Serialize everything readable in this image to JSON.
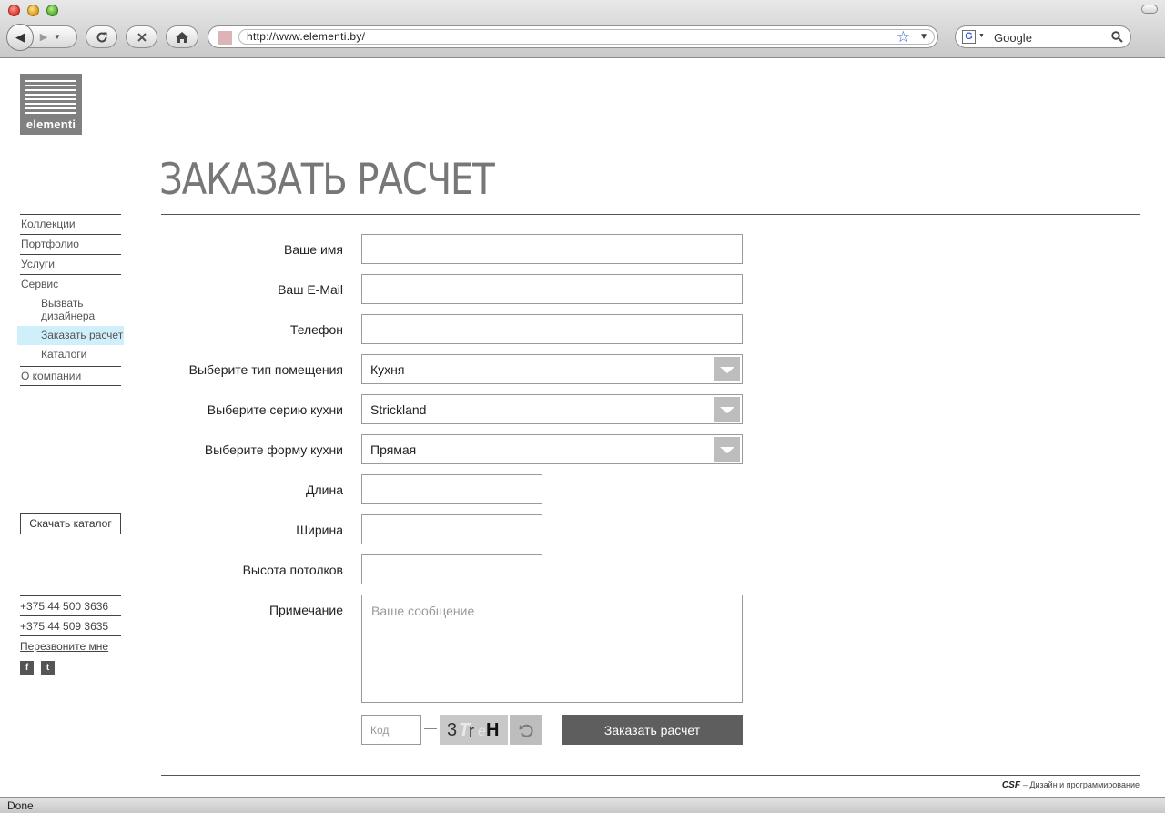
{
  "browser": {
    "url": "http://www.elementi.by/",
    "search_placeholder": "Google",
    "status": "Done"
  },
  "logo": {
    "text": "elementi"
  },
  "sidebar": {
    "items": [
      {
        "label": "Коллекции"
      },
      {
        "label": "Портфолио"
      },
      {
        "label": "Услуги"
      },
      {
        "label": "Сервис"
      },
      {
        "label": "О компании"
      }
    ],
    "subitems": [
      {
        "label": "Вызвать дизайнера"
      },
      {
        "label": "Заказать расчет",
        "active": true
      },
      {
        "label": "Каталоги"
      }
    ],
    "download_catalog": "Скачать каталог",
    "phones": [
      "+375 44 500 3636",
      "+375 44 509 3635"
    ],
    "callback": "Перезвоните мне",
    "social": {
      "facebook": "f",
      "twitter": "t"
    }
  },
  "page": {
    "title": "ЗАКАЗАТЬ РАСЧЕТ"
  },
  "form": {
    "name_label": "Ваше имя",
    "name_value": "",
    "email_label": "Ваш E-Mail",
    "email_value": "",
    "phone_label": "Телефон",
    "phone_value": "",
    "room_type_label": "Выберите тип помещения",
    "room_type_value": "Кухня",
    "series_label": "Выберите серию кухни",
    "series_value": "Strickland",
    "shape_label": "Выберите форму кухни",
    "shape_value": "Прямая",
    "length_label": "Длина",
    "length_value": "",
    "width_label": "Ширина",
    "width_value": "",
    "ceiling_label": "Высота потолков",
    "ceiling_value": "",
    "note_label": "Примечание",
    "note_placeholder": "Ваше сообщение",
    "code_placeholder": "Код",
    "captcha_chars": [
      "3",
      "T",
      "r",
      "e",
      "H"
    ],
    "submit_label": "Заказать расчет"
  },
  "footer": {
    "brand": "CSF",
    "credits": "– Дизайн и программирование"
  },
  "colors": {
    "logo_bg": "#808080",
    "active_nav_bg": "#cfeffa",
    "submit_bg": "#5e5e5e",
    "select_arrow_bg": "#bdbdbd"
  }
}
